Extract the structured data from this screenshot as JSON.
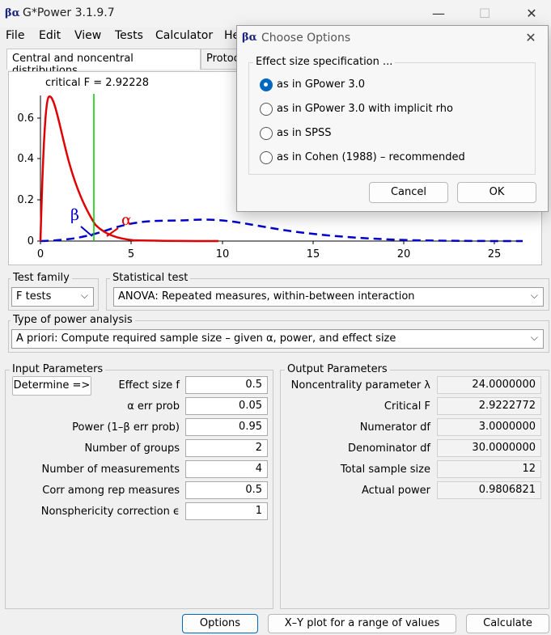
{
  "window": {
    "title": "G*Power 3.1.9.7",
    "minimize": "—",
    "maximize": "☐",
    "close": "✕"
  },
  "menu": [
    "File",
    "Edit",
    "View",
    "Tests",
    "Calculator",
    "He"
  ],
  "tabs": [
    {
      "label": "Central and noncentral distributions",
      "active": true
    },
    {
      "label": "Protoc",
      "active": false
    }
  ],
  "plot": {
    "critical_label": "critical F =  2.92228",
    "y_ticks": [
      "0.6",
      "0.4",
      "0.2",
      "0"
    ],
    "x_ticks": [
      "0",
      "5",
      "10",
      "15",
      "20",
      "25"
    ],
    "beta_symbol": "β",
    "alpha_symbol": "α",
    "colors": {
      "central": "#e00000",
      "noncentral": "#0000cc",
      "critical": "#00cc00"
    }
  },
  "test_family": {
    "label": "Test family",
    "value": "F tests"
  },
  "statistical_test": {
    "label": "Statistical test",
    "value": "ANOVA: Repeated measures, within-between interaction"
  },
  "power_analysis": {
    "label": "Type of power analysis",
    "value": "A priori: Compute required sample size – given α, power, and effect size"
  },
  "input": {
    "title": "Input Parameters",
    "determine": "Determine =>",
    "rows": [
      {
        "label": "Effect size f",
        "value": "0.5"
      },
      {
        "label": "α err prob",
        "value": "0.05"
      },
      {
        "label": "Power (1–β err prob)",
        "value": "0.95"
      },
      {
        "label": "Number of groups",
        "value": "2"
      },
      {
        "label": "Number of measurements",
        "value": "4"
      },
      {
        "label": "Corr among rep measures",
        "value": "0.5"
      },
      {
        "label": "Nonsphericity correction ϵ",
        "value": "1"
      }
    ]
  },
  "output": {
    "title": "Output Parameters",
    "rows": [
      {
        "label": "Noncentrality parameter λ",
        "value": "24.0000000"
      },
      {
        "label": "Critical F",
        "value": "2.9222772"
      },
      {
        "label": "Numerator df",
        "value": "3.0000000"
      },
      {
        "label": "Denominator df",
        "value": "30.0000000"
      },
      {
        "label": "Total sample size",
        "value": "12"
      },
      {
        "label": "Actual power",
        "value": "0.9806821"
      }
    ]
  },
  "bottom_buttons": {
    "options": "Options",
    "xy_plot": "X–Y plot for a range of values",
    "calculate": "Calculate"
  },
  "dialog": {
    "title": "Choose Options",
    "group_label": "Effect size specification ...",
    "options": [
      {
        "label": "as in GPower 3.0",
        "selected": true
      },
      {
        "label": "as in GPower 3.0 with implicit rho",
        "selected": false
      },
      {
        "label": "as in SPSS",
        "selected": false
      },
      {
        "label": "as in Cohen (1988) – recommended",
        "selected": false
      }
    ],
    "cancel": "Cancel",
    "ok": "OK"
  }
}
